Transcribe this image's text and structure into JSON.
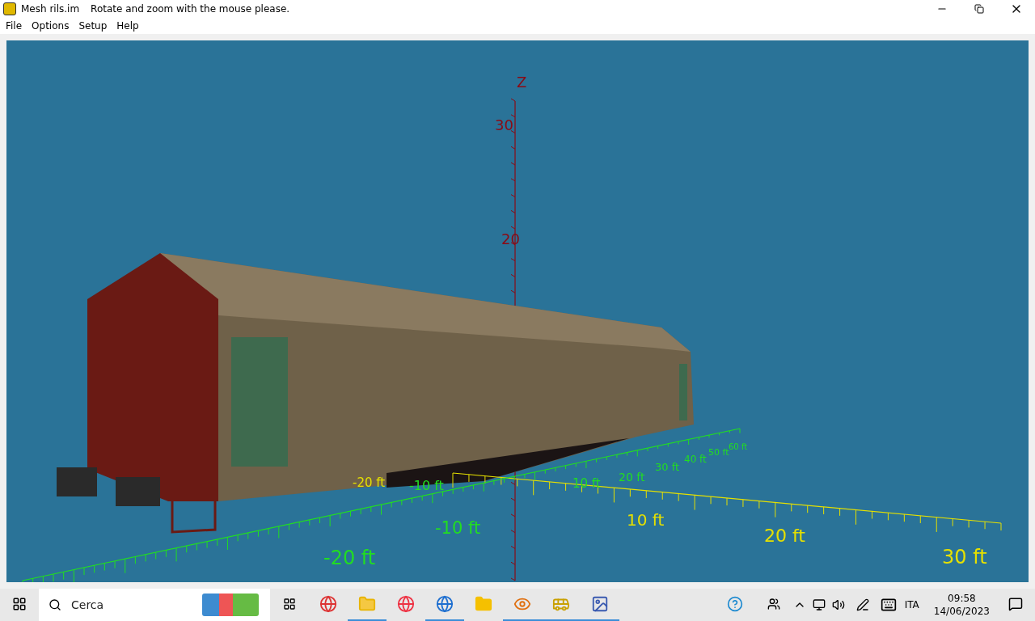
{
  "window": {
    "title": "Mesh rils.im",
    "hint": "Rotate and zoom with the mouse please."
  },
  "menu": [
    "File",
    "Options",
    "Setup",
    "Help"
  ],
  "viewport": {
    "axes": [
      {
        "kind": "z",
        "labels": [
          "Z",
          "30",
          "20"
        ]
      },
      {
        "kind": "x",
        "labels": [
          "-20 ft",
          "10 ft",
          "20 ft",
          "30 ft"
        ]
      },
      {
        "kind": "y",
        "labels": [
          "-20 ft",
          "-10 ft",
          "-10 ft",
          "10 ft",
          "20 ft",
          "30 ft",
          "40 ft",
          "50 ft",
          "60 ft"
        ]
      }
    ]
  },
  "taskbar": {
    "search": {
      "placeholder": "Cerca"
    },
    "language": "ITA",
    "time": "09:58",
    "date": "14/06/2023"
  }
}
